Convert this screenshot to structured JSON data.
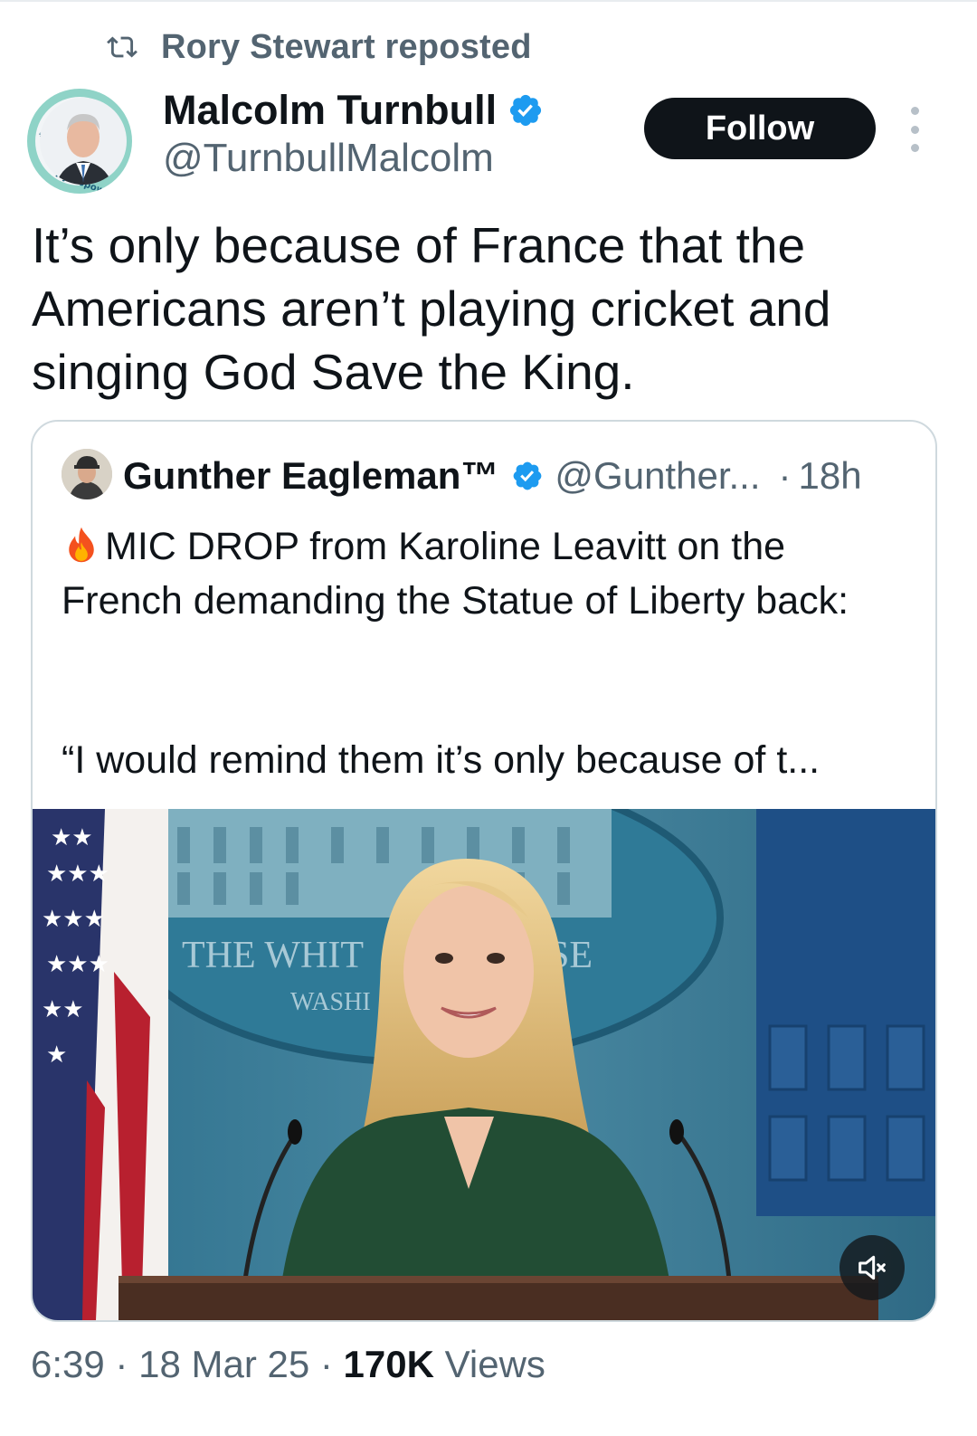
{
  "repost": {
    "label": "Rory Stewart reposted"
  },
  "author": {
    "name": "Malcolm Turnbull",
    "handle": "@TurnbullMalcolm",
    "avatar_ring_text": "#WithHydropower",
    "verified": true
  },
  "follow_button": {
    "label": "Follow"
  },
  "tweet": {
    "text": "It’s only because of France that the Americans aren’t playing cricket and singing God Save the King."
  },
  "quoted_tweet": {
    "author_name": "Gunther Eagleman™",
    "handle": "@Gunther...",
    "separator": "·",
    "time": "18h",
    "verified": true,
    "body_emoji": "fire-icon",
    "body": "MIC DROP from Karoline Leavitt on the French demanding the Statue of Liberty back:",
    "quote_line": "“I would remind them it’s only because of t...",
    "video": {
      "sign_line1": "THE WHIT",
      "sign_line1b": "SE",
      "sign_line2": "WASHI",
      "mute_icon": "volume-muted-icon"
    }
  },
  "meta": {
    "time": "6:39",
    "date": "18 Mar 25",
    "views_count": "170K",
    "views_label": "Views",
    "separator": "·"
  },
  "colors": {
    "text_primary": "#0f1419",
    "text_secondary": "#536471",
    "verified_blue": "#1d9bf0",
    "border": "#cfd9de",
    "follow_bg": "#0f1419"
  }
}
